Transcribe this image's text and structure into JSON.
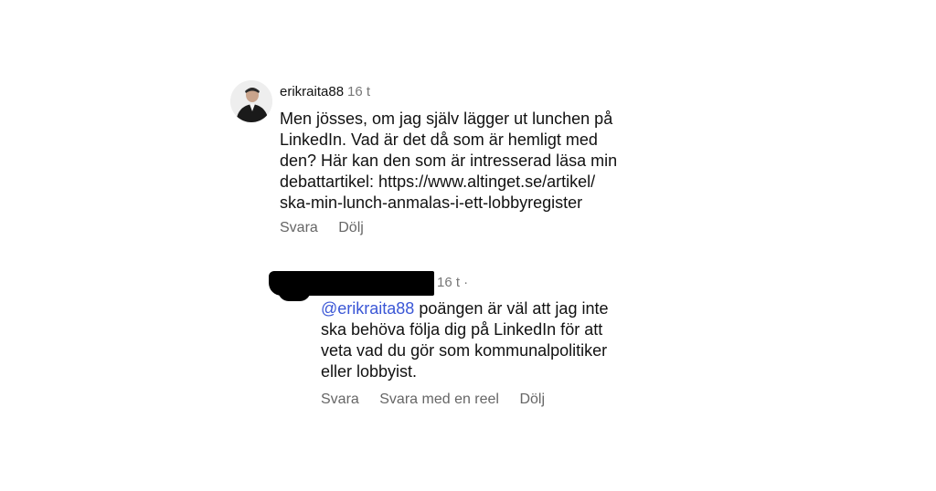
{
  "comment1": {
    "username": "erikraita88",
    "time": "16 t",
    "lines": [
      "Men jösses, om jag själv lägger ut lunchen på",
      "LinkedIn. Vad är det då som är hemligt med",
      "den? Här kan den som är intresserad läsa min",
      "debattartikel: https://www.altinget.se/artikel/",
      "ska-min-lunch-anmalas-i-ett-lobbyregister"
    ],
    "actions": {
      "reply": "Svara",
      "hide": "Dölj"
    }
  },
  "comment2": {
    "time": "16 t ·",
    "mention": "@erikraita88",
    "first_line_rest": " poängen är väl att jag inte",
    "lines": [
      "ska behöva följa dig på LinkedIn för att",
      "veta vad du gör som kommunalpolitiker",
      "eller lobbyist."
    ],
    "actions": {
      "reply": "Svara",
      "reply_reel": "Svara med en reel",
      "hide": "Dölj"
    }
  }
}
